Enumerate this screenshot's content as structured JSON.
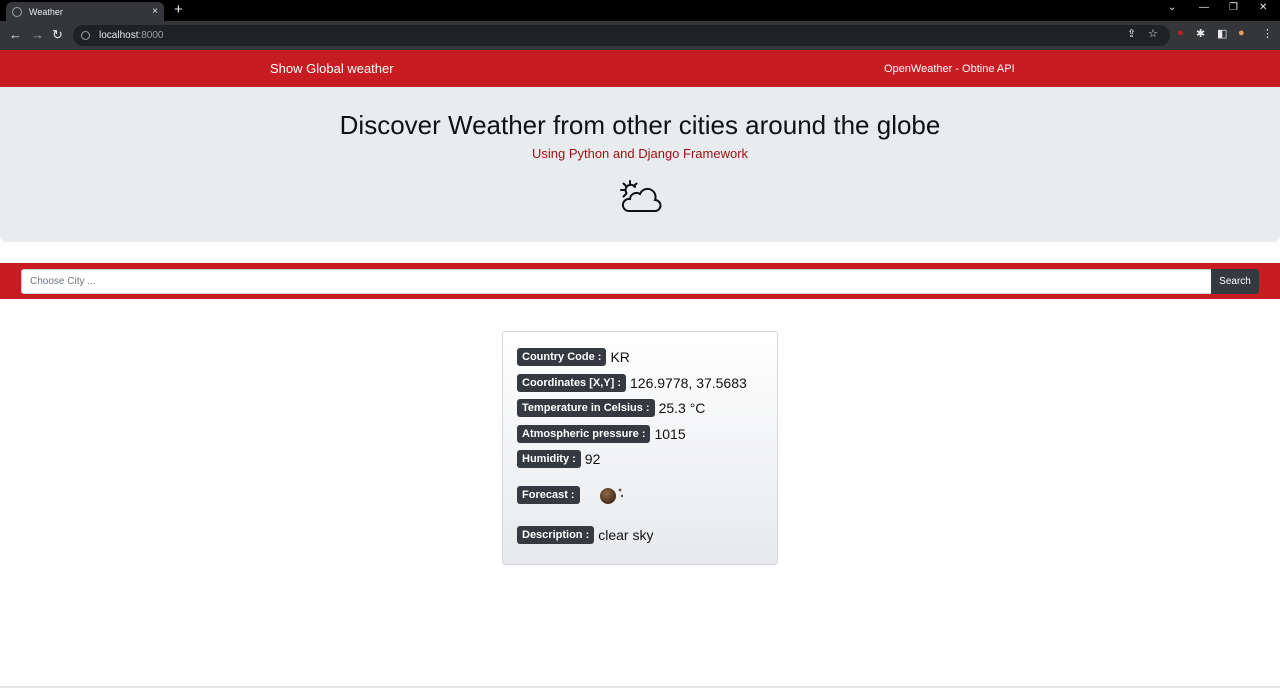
{
  "browser": {
    "tab_title": "Weather",
    "tab_close": "×",
    "new_tab": "+",
    "url_host": "localhost",
    "url_port": ":8000",
    "window_controls": [
      "⌄",
      "—",
      "❐",
      "✕"
    ]
  },
  "nav": {
    "brand": "Show Global weather",
    "link": "OpenWeather - Obtine API"
  },
  "hero": {
    "title": "Discover Weather from other cities around the globe",
    "subtitle": "Using Python and Django Framework",
    "icon": "sun-behind-cloud-icon"
  },
  "search": {
    "placeholder": "Choose City ...",
    "button_label": "Search"
  },
  "weather": {
    "country_code_label": "Country Code :",
    "country_code": "KR",
    "coordinates_label": "Coordinates [X,Y] :",
    "coordinates": "126.9778, 37.5683",
    "temperature_label": "Temperature in Celsius :",
    "temperature": "25.3 °C",
    "pressure_label": "Atmospheric pressure :",
    "pressure": "1015",
    "humidity_label": "Humidity :",
    "humidity": "92",
    "forecast_label": "Forecast :",
    "forecast_icon": "clear-sky-night-icon",
    "description_label": "Description :",
    "description": "clear sky"
  },
  "colors": {
    "brand_red": "#c71c22",
    "badge_dark": "#343a40",
    "jumbotron_bg": "#e9ecef",
    "subtitle_red": "#9b1111"
  }
}
